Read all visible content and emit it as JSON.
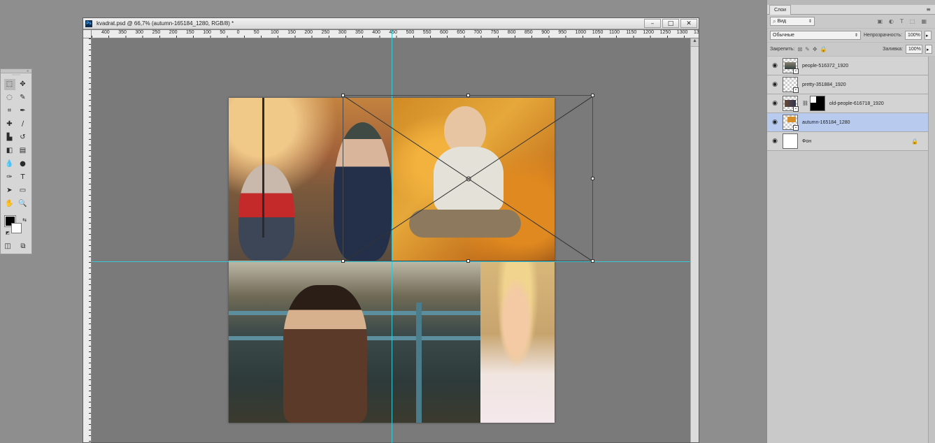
{
  "document": {
    "title": "kvadrat.psd @ 66,7% (autumn-165184_1280, RGB/8) *",
    "app_badge": "Ps",
    "window_buttons": [
      "–",
      "□",
      "✕"
    ]
  },
  "ruler": {
    "labels": [
      "400",
      "350",
      "300",
      "250",
      "200",
      "150",
      "100",
      "50",
      "0",
      "50",
      "100",
      "150",
      "200",
      "250",
      "300",
      "350",
      "400",
      "450",
      "500",
      "550",
      "600",
      "650",
      "700",
      "750",
      "800",
      "850",
      "900",
      "950",
      "1000",
      "1050",
      "1100",
      "1150",
      "1200",
      "1250",
      "1300",
      "135"
    ]
  },
  "tools": [
    [
      "marquee-icon",
      "move-icon"
    ],
    [
      "lasso-icon",
      "quick-selection-icon"
    ],
    [
      "crop-icon",
      "eyedropper-icon"
    ],
    [
      "healing-icon",
      "brush-icon"
    ],
    [
      "stamp-icon",
      "history-brush-icon"
    ],
    [
      "eraser-icon",
      "gradient-icon"
    ],
    [
      "blur-icon",
      "dodge-icon"
    ],
    [
      "pen-icon",
      "type-icon"
    ],
    [
      "path-select-icon",
      "rectangle-icon"
    ],
    [
      "hand-icon",
      "zoom-icon"
    ]
  ],
  "tool_glyphs": {
    "marquee-icon": "⬚",
    "move-icon": "✥",
    "lasso-icon": "◌",
    "quick-selection-icon": "✎",
    "crop-icon": "⌗",
    "eyedropper-icon": "✒",
    "healing-icon": "✚",
    "brush-icon": "∕",
    "stamp-icon": "▙",
    "history-brush-icon": "↺",
    "eraser-icon": "◧",
    "gradient-icon": "▤",
    "blur-icon": "💧",
    "dodge-icon": "●",
    "pen-icon": "✑",
    "type-icon": "T",
    "path-select-icon": "➤",
    "rectangle-icon": "▭",
    "hand-icon": "✋",
    "zoom-icon": "🔍"
  },
  "colors": {
    "foreground": "#000000",
    "background": "#ffffff",
    "guide": "#39c7d6",
    "selected_layer": "#b8cbee"
  },
  "layers_panel": {
    "tab": "Слои",
    "search_placeholder": "Вид",
    "blend_mode": "Обычные",
    "opacity_label": "Непрозрачность:",
    "opacity_value": "100%",
    "lock_label": "Закрепить:",
    "fill_label": "Заливка:",
    "fill_value": "100%",
    "layers": [
      {
        "name": "people-516372_1920",
        "selected": false,
        "has_mask": false,
        "locked": false
      },
      {
        "name": "pretty-351884_1920",
        "selected": false,
        "has_mask": false,
        "locked": false
      },
      {
        "name": "old-people-616718_1920",
        "selected": false,
        "has_mask": true,
        "locked": false
      },
      {
        "name": "autumn-165184_1280",
        "selected": true,
        "has_mask": false,
        "locked": false
      },
      {
        "name": "Фон",
        "selected": false,
        "has_mask": false,
        "locked": true
      }
    ]
  }
}
